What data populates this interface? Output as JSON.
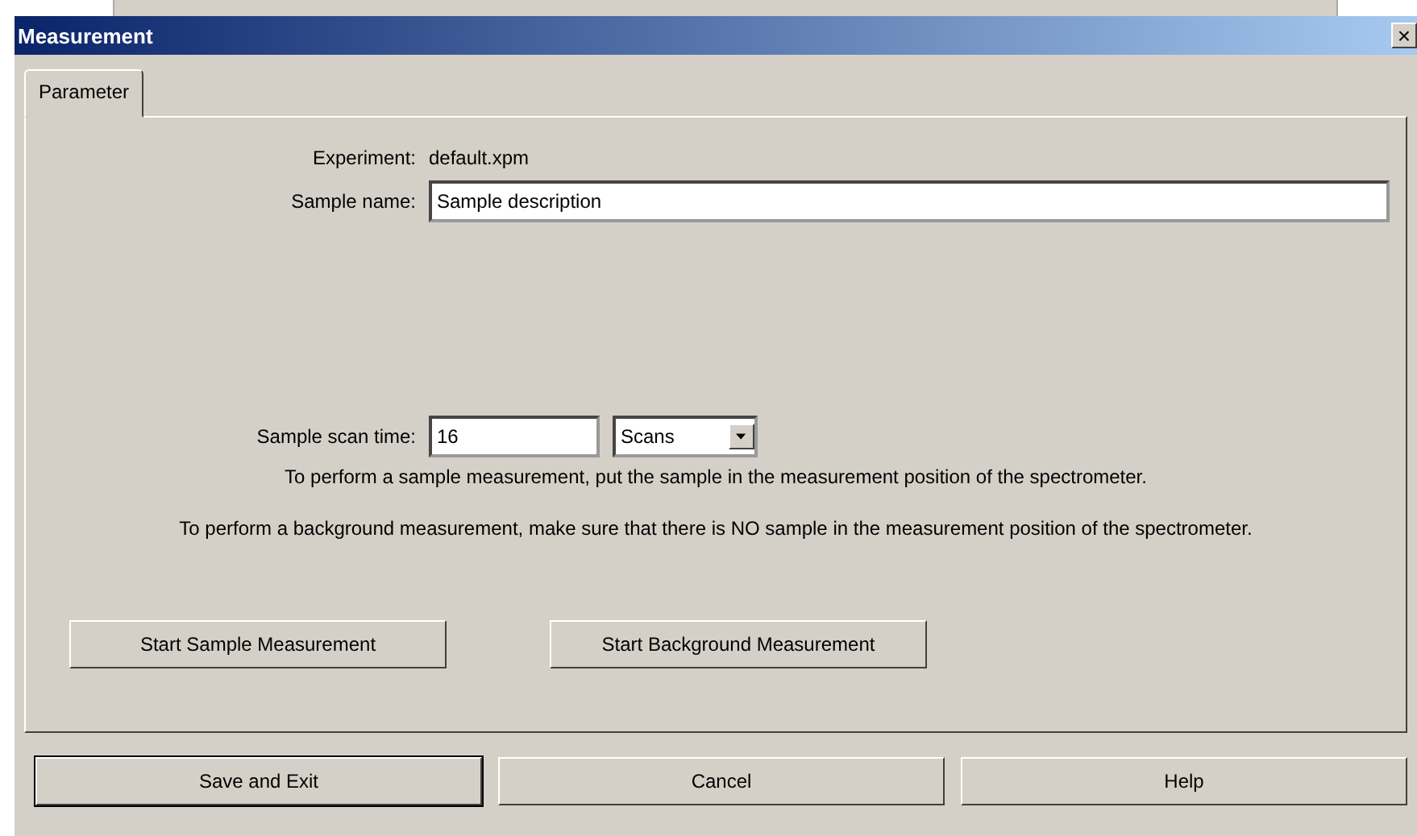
{
  "window": {
    "title": "Measurement",
    "close": "×"
  },
  "tabs": [
    {
      "label": "Parameter",
      "selected": true
    }
  ],
  "experiment": {
    "label": "Experiment:",
    "value": "default.xpm"
  },
  "sample_name": {
    "label": "Sample name:",
    "value": "Sample description"
  },
  "scan_time": {
    "label": "Sample scan time:",
    "value": "16",
    "unit": "Scans"
  },
  "instructions": [
    "To perform a sample measurement, put the sample in the measurement position of the spectrometer.",
    "To perform a background measurement, make sure that there is NO sample in the measurement position of the spectrometer."
  ],
  "panel_buttons": [
    "Start Sample Measurement",
    "Start Background Measurement"
  ],
  "dialog_buttons": [
    {
      "label": "Save and Exit",
      "default": true
    },
    {
      "label": "Cancel",
      "default": false
    },
    {
      "label": "Help",
      "default": false
    }
  ]
}
